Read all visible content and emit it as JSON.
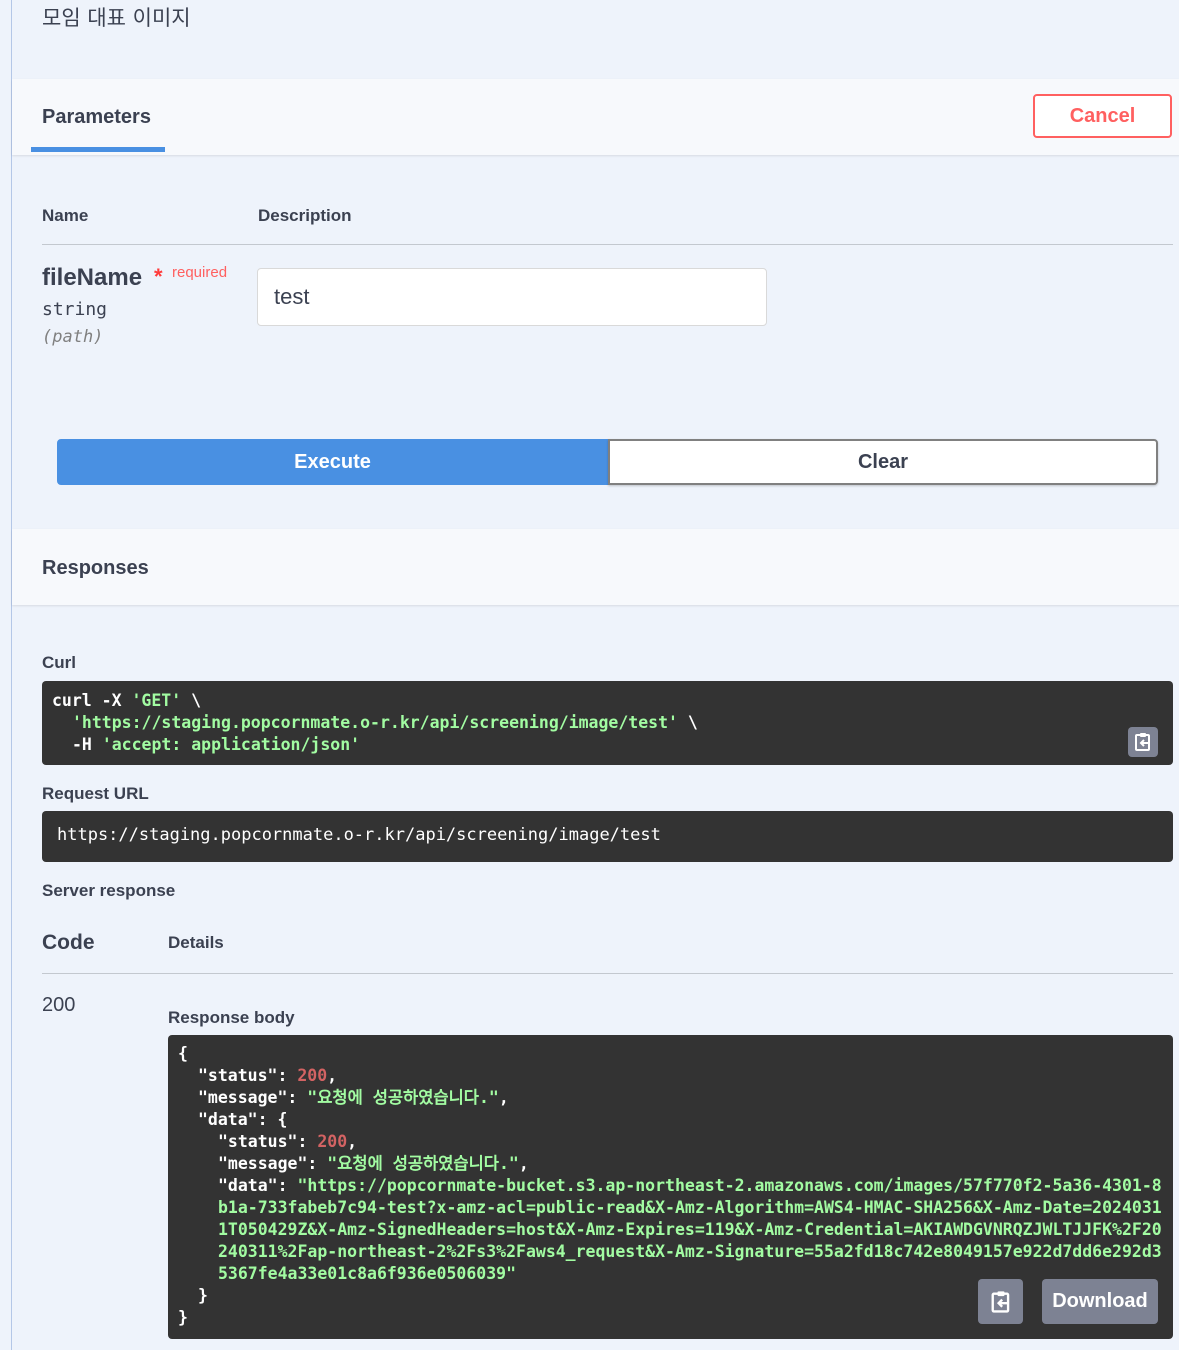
{
  "operation": {
    "description": "모임 대표 이미지"
  },
  "parameters_section": {
    "tab_label": "Parameters",
    "cancel_label": "Cancel"
  },
  "parameters_table": {
    "name_header": "Name",
    "description_header": "Description",
    "rows": [
      {
        "name": "fileName",
        "required_star": "*",
        "required_label": "required",
        "type": "string",
        "in": "(path)",
        "value": "test"
      }
    ]
  },
  "actions": {
    "execute_label": "Execute",
    "clear_label": "Clear"
  },
  "responses_section": {
    "title": "Responses"
  },
  "curl": {
    "label": "Curl",
    "line1_cmd": "curl -X ",
    "line1_method": "'GET'",
    "line1_tail": " \\",
    "line2_url": "'https://staging.popcornmate.o-r.kr/api/screening/image/test'",
    "line2_tail": " \\",
    "line3_flag": "-H ",
    "line3_header": "'accept: application/json'"
  },
  "request_url": {
    "label": "Request URL",
    "value": "https://staging.popcornmate.o-r.kr/api/screening/image/test"
  },
  "server_response": {
    "label": "Server response",
    "code_header": "Code",
    "details_header": "Details",
    "code": "200",
    "body_label": "Response body",
    "body": {
      "status": "200",
      "message": "\"요청에 성공하였습니다.\"",
      "data_status": "200",
      "data_message": "\"요청에 성공하였습니다.\"",
      "data_data": "\"https://popcornmate-bucket.s3.ap-northeast-2.amazonaws.com/images/57f770f2-5a36-4301-8b1a-733fabeb7c94-test?x-amz-acl=public-read&X-Amz-Algorithm=AWS4-HMAC-SHA256&X-Amz-Date=20240311T050429Z&X-Amz-SignedHeaders=host&X-Amz-Expires=119&X-Amz-Credential=AKIAWDGVNRQZJWLTJJFK%2F20240311%2Fap-northeast-2%2Fs3%2Faws4_request&X-Amz-Signature=55a2fd18c742e8049157e922d7dd6e292d35367fe4a33e01c8a6f936e0506039\""
    },
    "download_label": "Download"
  },
  "icons": {
    "copy": "clipboard-copy-icon"
  },
  "colors": {
    "accent": "#4990e2",
    "cancel": "#ff6060",
    "code_bg": "#333333",
    "string": "#a2fca2",
    "number": "#d36363"
  }
}
